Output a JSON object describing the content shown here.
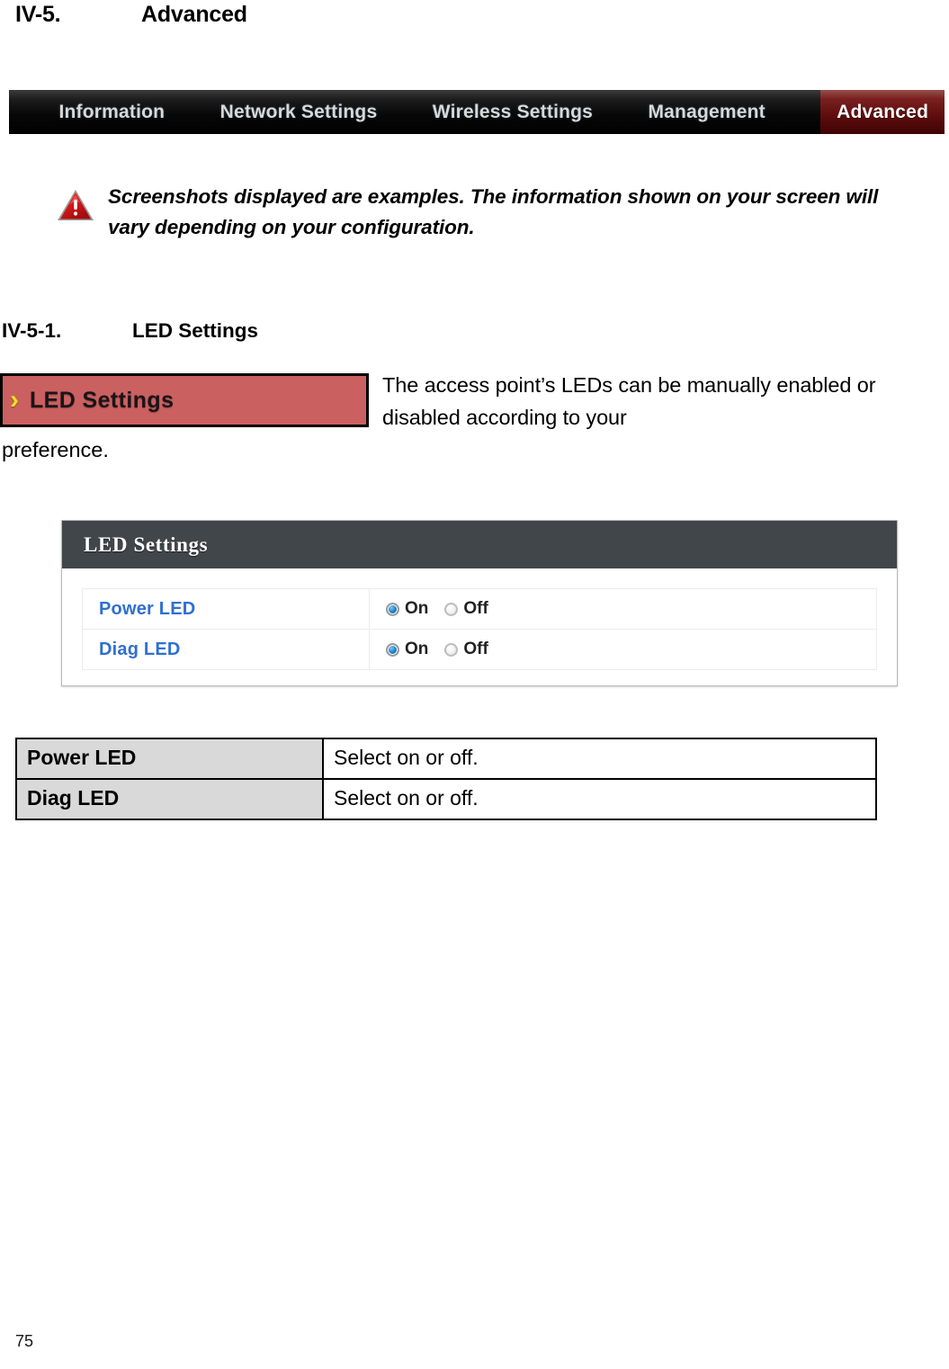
{
  "heading": {
    "number": "IV-5.",
    "title": "Advanced"
  },
  "navbar": {
    "items": [
      {
        "label": "Information",
        "active": false
      },
      {
        "label": "Network Settings",
        "active": false
      },
      {
        "label": "Wireless Settings",
        "active": false
      },
      {
        "label": "Management",
        "active": false
      },
      {
        "label": "Advanced",
        "active": true
      }
    ],
    "active_tab_color": "#7b2020",
    "background_color": "#000000",
    "text_color": "#d8d8d8"
  },
  "note": {
    "icon": "warning-triangle-icon",
    "icon_color": "#d81f1f",
    "text": "Screenshots displayed are examples. The information shown on your screen will vary depending on your configuration."
  },
  "subheading": {
    "number": "IV-5-1.",
    "title": "LED Settings"
  },
  "menu_chip": {
    "arrow": "›",
    "arrow_color": "#ece516",
    "label": "LED Settings",
    "background_color": "#cb6060"
  },
  "body_text": {
    "line1": "The access point’s LEDs can be manually",
    "line2": "enabled or disabled according to your",
    "line3": "preference."
  },
  "panel": {
    "header_title": "LED Settings",
    "header_color": "#41464a",
    "rows": [
      {
        "label": "Power LED",
        "options": [
          {
            "label": "On",
            "selected": true
          },
          {
            "label": "Off",
            "selected": false
          }
        ]
      },
      {
        "label": "Diag LED",
        "options": [
          {
            "label": "On",
            "selected": true
          },
          {
            "label": "Off",
            "selected": false
          }
        ]
      }
    ]
  },
  "desc_table": {
    "rows": [
      {
        "term": "Power LED",
        "definition": "Select on or off."
      },
      {
        "term": "Diag LED",
        "definition": "Select on or off."
      }
    ]
  },
  "footer": {
    "page_number": "75"
  }
}
